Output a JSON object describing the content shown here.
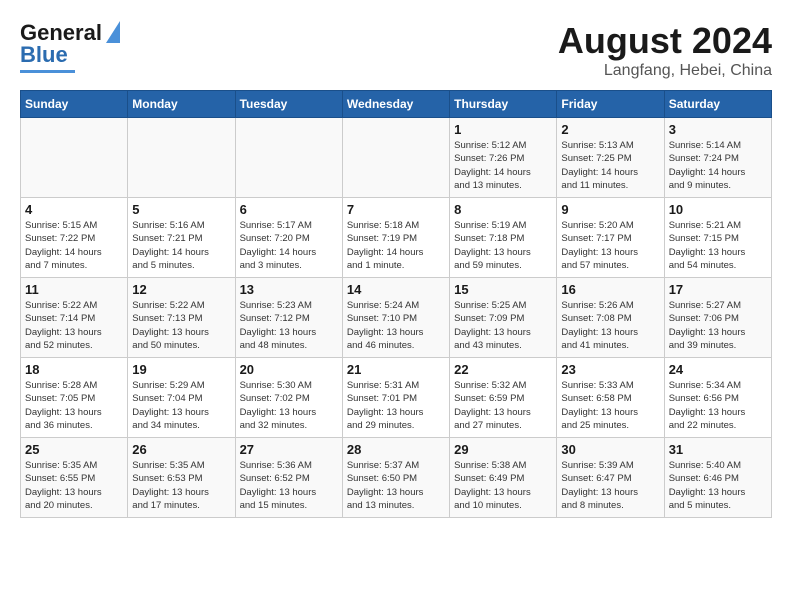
{
  "header": {
    "logo_line1": "General",
    "logo_line2": "Blue",
    "month": "August 2024",
    "location": "Langfang, Hebei, China"
  },
  "days_of_week": [
    "Sunday",
    "Monday",
    "Tuesday",
    "Wednesday",
    "Thursday",
    "Friday",
    "Saturday"
  ],
  "weeks": [
    [
      {
        "day": "",
        "info": ""
      },
      {
        "day": "",
        "info": ""
      },
      {
        "day": "",
        "info": ""
      },
      {
        "day": "",
        "info": ""
      },
      {
        "day": "1",
        "info": "Sunrise: 5:12 AM\nSunset: 7:26 PM\nDaylight: 14 hours\nand 13 minutes."
      },
      {
        "day": "2",
        "info": "Sunrise: 5:13 AM\nSunset: 7:25 PM\nDaylight: 14 hours\nand 11 minutes."
      },
      {
        "day": "3",
        "info": "Sunrise: 5:14 AM\nSunset: 7:24 PM\nDaylight: 14 hours\nand 9 minutes."
      }
    ],
    [
      {
        "day": "4",
        "info": "Sunrise: 5:15 AM\nSunset: 7:22 PM\nDaylight: 14 hours\nand 7 minutes."
      },
      {
        "day": "5",
        "info": "Sunrise: 5:16 AM\nSunset: 7:21 PM\nDaylight: 14 hours\nand 5 minutes."
      },
      {
        "day": "6",
        "info": "Sunrise: 5:17 AM\nSunset: 7:20 PM\nDaylight: 14 hours\nand 3 minutes."
      },
      {
        "day": "7",
        "info": "Sunrise: 5:18 AM\nSunset: 7:19 PM\nDaylight: 14 hours\nand 1 minute."
      },
      {
        "day": "8",
        "info": "Sunrise: 5:19 AM\nSunset: 7:18 PM\nDaylight: 13 hours\nand 59 minutes."
      },
      {
        "day": "9",
        "info": "Sunrise: 5:20 AM\nSunset: 7:17 PM\nDaylight: 13 hours\nand 57 minutes."
      },
      {
        "day": "10",
        "info": "Sunrise: 5:21 AM\nSunset: 7:15 PM\nDaylight: 13 hours\nand 54 minutes."
      }
    ],
    [
      {
        "day": "11",
        "info": "Sunrise: 5:22 AM\nSunset: 7:14 PM\nDaylight: 13 hours\nand 52 minutes."
      },
      {
        "day": "12",
        "info": "Sunrise: 5:22 AM\nSunset: 7:13 PM\nDaylight: 13 hours\nand 50 minutes."
      },
      {
        "day": "13",
        "info": "Sunrise: 5:23 AM\nSunset: 7:12 PM\nDaylight: 13 hours\nand 48 minutes."
      },
      {
        "day": "14",
        "info": "Sunrise: 5:24 AM\nSunset: 7:10 PM\nDaylight: 13 hours\nand 46 minutes."
      },
      {
        "day": "15",
        "info": "Sunrise: 5:25 AM\nSunset: 7:09 PM\nDaylight: 13 hours\nand 43 minutes."
      },
      {
        "day": "16",
        "info": "Sunrise: 5:26 AM\nSunset: 7:08 PM\nDaylight: 13 hours\nand 41 minutes."
      },
      {
        "day": "17",
        "info": "Sunrise: 5:27 AM\nSunset: 7:06 PM\nDaylight: 13 hours\nand 39 minutes."
      }
    ],
    [
      {
        "day": "18",
        "info": "Sunrise: 5:28 AM\nSunset: 7:05 PM\nDaylight: 13 hours\nand 36 minutes."
      },
      {
        "day": "19",
        "info": "Sunrise: 5:29 AM\nSunset: 7:04 PM\nDaylight: 13 hours\nand 34 minutes."
      },
      {
        "day": "20",
        "info": "Sunrise: 5:30 AM\nSunset: 7:02 PM\nDaylight: 13 hours\nand 32 minutes."
      },
      {
        "day": "21",
        "info": "Sunrise: 5:31 AM\nSunset: 7:01 PM\nDaylight: 13 hours\nand 29 minutes."
      },
      {
        "day": "22",
        "info": "Sunrise: 5:32 AM\nSunset: 6:59 PM\nDaylight: 13 hours\nand 27 minutes."
      },
      {
        "day": "23",
        "info": "Sunrise: 5:33 AM\nSunset: 6:58 PM\nDaylight: 13 hours\nand 25 minutes."
      },
      {
        "day": "24",
        "info": "Sunrise: 5:34 AM\nSunset: 6:56 PM\nDaylight: 13 hours\nand 22 minutes."
      }
    ],
    [
      {
        "day": "25",
        "info": "Sunrise: 5:35 AM\nSunset: 6:55 PM\nDaylight: 13 hours\nand 20 minutes."
      },
      {
        "day": "26",
        "info": "Sunrise: 5:35 AM\nSunset: 6:53 PM\nDaylight: 13 hours\nand 17 minutes."
      },
      {
        "day": "27",
        "info": "Sunrise: 5:36 AM\nSunset: 6:52 PM\nDaylight: 13 hours\nand 15 minutes."
      },
      {
        "day": "28",
        "info": "Sunrise: 5:37 AM\nSunset: 6:50 PM\nDaylight: 13 hours\nand 13 minutes."
      },
      {
        "day": "29",
        "info": "Sunrise: 5:38 AM\nSunset: 6:49 PM\nDaylight: 13 hours\nand 10 minutes."
      },
      {
        "day": "30",
        "info": "Sunrise: 5:39 AM\nSunset: 6:47 PM\nDaylight: 13 hours\nand 8 minutes."
      },
      {
        "day": "31",
        "info": "Sunrise: 5:40 AM\nSunset: 6:46 PM\nDaylight: 13 hours\nand 5 minutes."
      }
    ]
  ]
}
